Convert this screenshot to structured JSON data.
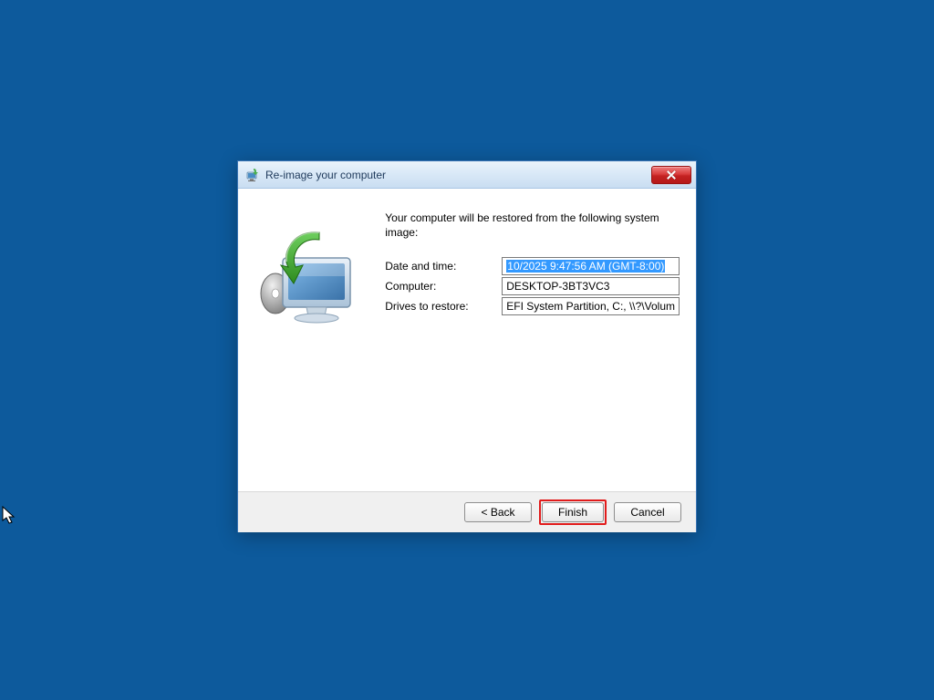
{
  "dialog": {
    "title": "Re-image your computer",
    "intro": "Your computer will be restored from the following system image:",
    "fields": {
      "date_label": "Date and time:",
      "date_value": "10/2025 9:47:56 AM (GMT-8:00)",
      "computer_label": "Computer:",
      "computer_value": "DESKTOP-3BT3VC3",
      "drives_label": "Drives to restore:",
      "drives_value": "EFI System Partition, C:, \\\\?\\Volum"
    },
    "buttons": {
      "back": "< Back",
      "finish": "Finish",
      "cancel": "Cancel"
    }
  }
}
